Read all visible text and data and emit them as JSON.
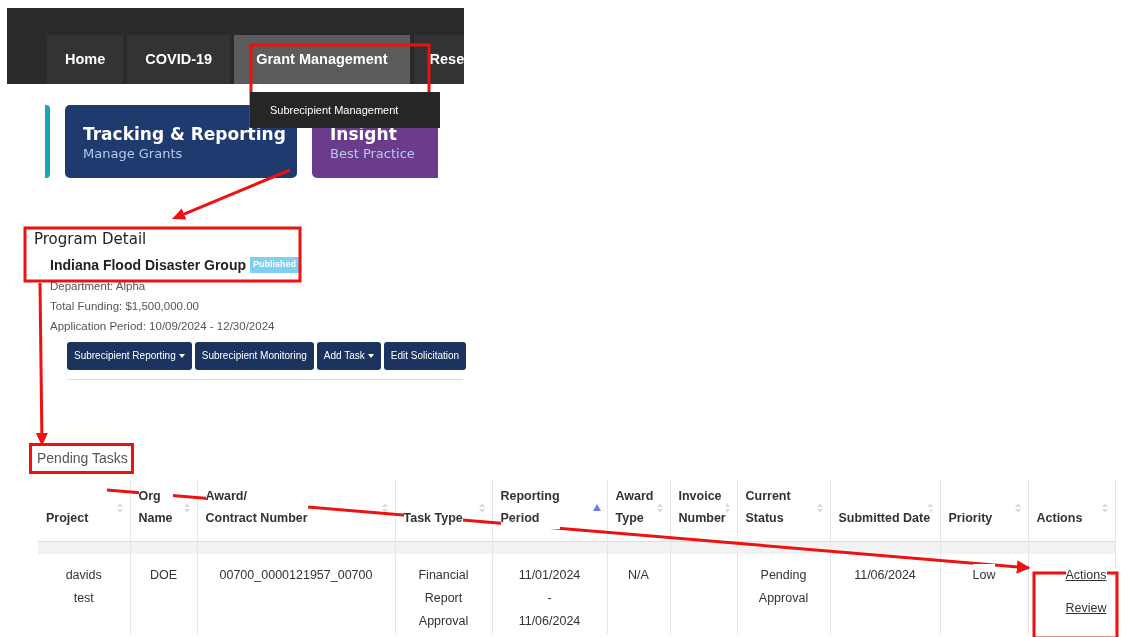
{
  "nav": {
    "items": [
      {
        "label": "Home",
        "selected": false
      },
      {
        "label": "COVID-19",
        "selected": false
      },
      {
        "label": "Grant Management",
        "selected": true
      },
      {
        "label": "Rese",
        "selected": false
      }
    ],
    "dropdown": [
      "Subrecipient Management"
    ]
  },
  "tiles": [
    {
      "title": "Tracking & Reporting",
      "subtitle": "Manage Grants",
      "color": "#1e3a6e"
    },
    {
      "title": "Insight",
      "subtitle": "Best Practice",
      "color": "#6b3c8c"
    }
  ],
  "program": {
    "heading": "Program Detail",
    "name": "Indiana Flood Disaster Group",
    "badge": "Published",
    "details": [
      "Department: Alpha",
      "Total Funding: $1,500,000.00",
      "Application Period: 10/09/2024 - 12/30/2024"
    ],
    "buttons": [
      {
        "label": "Subrecipient Reporting",
        "dropdown": true
      },
      {
        "label": "Subrecipient Monitoring",
        "dropdown": false
      },
      {
        "label": "Add Task",
        "dropdown": true
      },
      {
        "label": "Edit Solicitation",
        "dropdown": false
      }
    ]
  },
  "pending_tasks": {
    "title": "Pending Tasks",
    "table": {
      "columns": [
        {
          "label": "Project",
          "sorted": false
        },
        {
          "label": "Org\nName",
          "sorted": false
        },
        {
          "label": "Award/\nContract Number",
          "sorted": false
        },
        {
          "label": "Task Type",
          "sorted": false
        },
        {
          "label": "Reporting\nPeriod",
          "sorted": true
        },
        {
          "label": "Award\nType",
          "sorted": false
        },
        {
          "label": "Invoice\nNumber",
          "sorted": false
        },
        {
          "label": "Current\nStatus",
          "sorted": false
        },
        {
          "label": "Submitted Date",
          "sorted": false
        },
        {
          "label": "Priority",
          "sorted": false
        },
        {
          "label": "Actions",
          "sorted": false
        }
      ],
      "rows": [
        {
          "cells": [
            "davids\ntest",
            "DOE",
            "00700_0000121957_00700",
            "Financial\nReport\nApproval",
            "11/01/2024\n-\n11/06/2024",
            "N/A",
            "",
            "Pending\nApproval",
            "11/06/2024",
            "Low"
          ],
          "actions": [
            "Actions",
            "Review"
          ]
        }
      ]
    }
  }
}
